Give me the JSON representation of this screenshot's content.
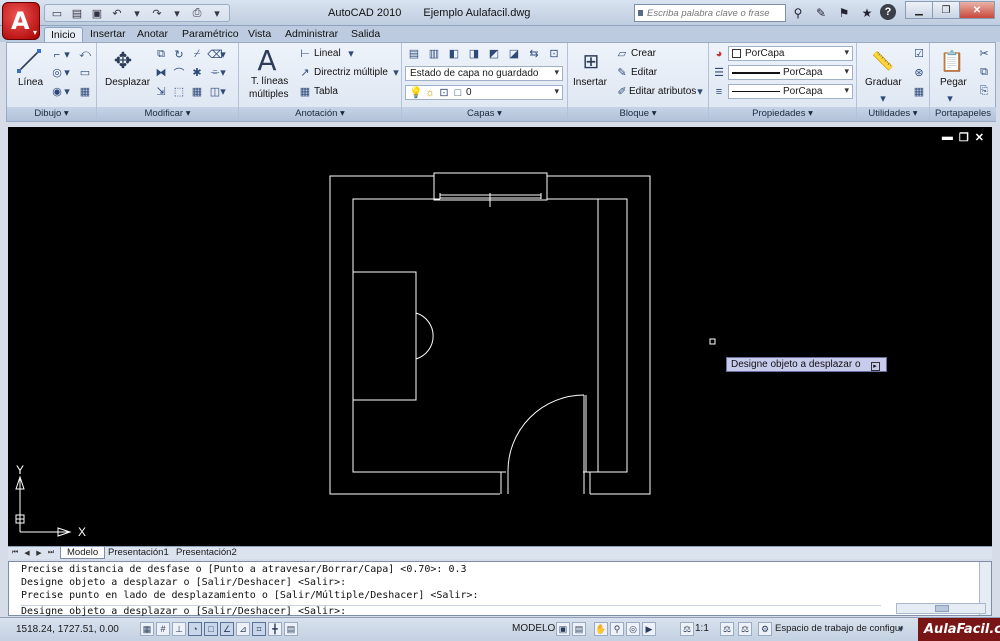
{
  "window": {
    "app_name": "AutoCAD 2010",
    "file_name": "Ejemplo Aulafacil.dwg",
    "search_placeholder": "Escriba palabra clave o frase"
  },
  "ribbon_tabs": [
    "Inicio",
    "Insertar",
    "Anotar",
    "Paramétrico",
    "Vista",
    "Administrar",
    "Salida"
  ],
  "ribbon": {
    "draw": {
      "title": "Dibujo",
      "line_label": "Línea"
    },
    "modify": {
      "title": "Modificar",
      "move_label": "Desplazar"
    },
    "annotation": {
      "title": "Anotación",
      "mtext_label_1": "T. líneas",
      "mtext_label_2": "múltiples",
      "linear_label": "Lineal",
      "leader_label": "Directriz múltiple",
      "table_label": "Tabla"
    },
    "layers": {
      "title": "Capas",
      "layer_state": "Estado de capa no guardado",
      "current_layer": "0"
    },
    "block": {
      "title": "Bloque",
      "insert_label": "Insertar",
      "create_label": "Crear",
      "edit_label": "Editar",
      "edit_attributes_label": "Editar atributos"
    },
    "properties": {
      "title": "Propiedades",
      "color": "PorCapa",
      "linetype": "PorCapa",
      "lineweight": "PorCapa"
    },
    "utilities": {
      "title": "Utilidades",
      "measure_label": "Graduar"
    },
    "clipboard": {
      "title": "Portapapeles",
      "paste_label": "Pegar"
    }
  },
  "viewport": {
    "tooltip": "Designe objeto a desplazar o",
    "ucs_y": "Y",
    "ucs_x": "X"
  },
  "layout_tabs": [
    "Modelo",
    "Presentación1",
    "Presentación2"
  ],
  "command_history": [
    "Precise distancia de desfase o [Punto a atravesar/Borrar/Capa] <0.70>: 0.3",
    "Designe objeto a desplazar o [Salir/Deshacer] <Salir>:",
    "Precise punto en lado de desplazamiento o [Salir/Múltiple/Deshacer] <Salir>:",
    "Designe objeto a desplazar o [Salir/Deshacer] <Salir>:"
  ],
  "status": {
    "coordinates": "1518.24, 1727.51, 0.00",
    "model_label": "MODELO",
    "scale": "1:1",
    "workspace": "Espacio de trabajo de configura",
    "watermark": "AulaFacil.com"
  }
}
